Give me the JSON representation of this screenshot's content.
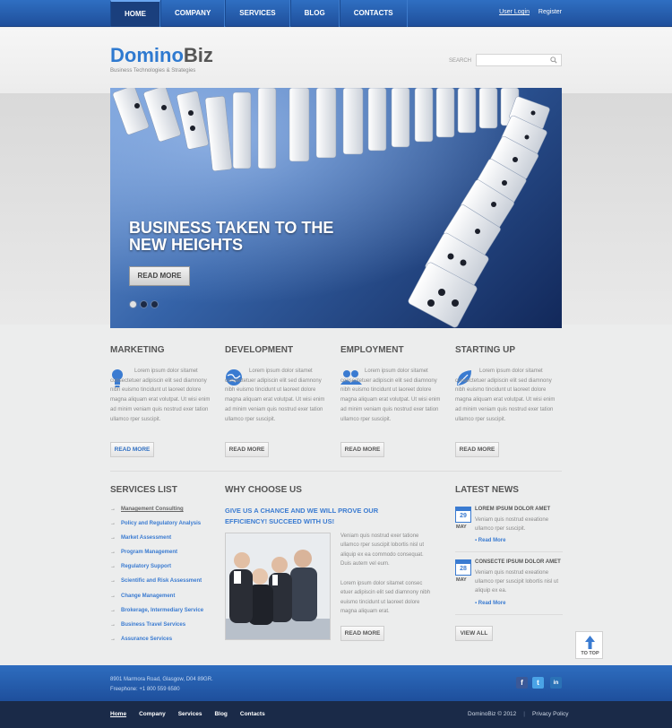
{
  "nav": {
    "items": [
      "HOME",
      "COMPANY",
      "SERVICES",
      "BLOG",
      "CONTACTS"
    ],
    "active": "HOME",
    "user_login": "User Login",
    "register": "Register"
  },
  "header": {
    "logo_part1": "Domino",
    "logo_part2": "Biz",
    "tagline": "Business Technologies & Strategies",
    "search_label": "SEARCH",
    "search_value": ""
  },
  "slider": {
    "title": "BUSINESS TAKEN TO THE NEW HEIGHTS",
    "button": "READ MORE",
    "slides": 3,
    "active_slide": 1
  },
  "features": [
    {
      "title": "MARKETING",
      "icon": "lightbulb-icon",
      "text": "Lorem ipsum dolor sitamet consectetuer adipiscin elit sed diamnony nibh euismo tincidunt ut laoreet dolore magna aliquam erat volutpat. Ut wisi enim ad minim veniam quis nostrud exer tation ullamco rper suscipit.",
      "button": "READ MORE"
    },
    {
      "title": "DEVELOPMENT",
      "icon": "globe-icon",
      "text": "Lorem ipsum dolor sitamet consectetuer adipiscin elit sed diamnony nibh euismo tincidunt ut laoreet dolore magna aliquam erat volutpat. Ut wisi enim ad minim veniam quis nostrud exer tation ullamco rper suscipit.",
      "button": "READ MORE"
    },
    {
      "title": "EMPLOYMENT",
      "icon": "users-icon",
      "text": "Lorem ipsum dolor sitamet consectetuer adipiscin elit sed diamnony nibh euismo tincidunt ut laoreet dolore magna aliquam erat volutpat. Ut wisi enim ad minim veniam quis nostrud exer tation ullamco rper suscipit.",
      "button": "READ MORE"
    },
    {
      "title": "STARTING UP",
      "icon": "leaf-icon",
      "text": "Lorem ipsum dolor sitamet consectetuer adipiscin elit sed diamnony nibh euismo tincidunt ut laoreet dolore magna aliquam erat volutpat. Ut wisi enim ad minim veniam quis nostrud exer tation ullamco rper suscipit.",
      "button": "READ MORE"
    }
  ],
  "services": {
    "title": "SERVICES LIST",
    "items": [
      "Management Consulting",
      "Policy and Regulatory Analysis",
      "Market Assessment",
      "Program Management",
      "Regulatory Support",
      "Scientific and Risk Assessment",
      "Change Management",
      "Brokerage, Intermediary Service",
      "Business Travel Services",
      "Assurance Services"
    ]
  },
  "why": {
    "title": "WHY CHOOSE US",
    "headline": "GIVE US A CHANCE AND WE WILL PROVE OUR EFFICIENCY! SUCCEED WITH US!",
    "para1": "Veniam quis nostrud exer tatione ullamco rper suscipit lobortis nisl ut aliquip ex ea commodo consequat. Duis autem vel eum.",
    "para2": "Lorem ipsum dolor sitamet consec etuer adipiscin elit sed diamnony nibh euismo tincidunt ut laoreet dolore magna aliquam erat.",
    "button": "READ MORE"
  },
  "news": {
    "title": "LATEST NEWS",
    "items": [
      {
        "day": "29",
        "month": "MAY",
        "title": "LOREM IPSUM DOLOR AMET",
        "text": "Veniam quis nostrud exeatione ullamco rper suscipit.",
        "more": "Read More"
      },
      {
        "day": "28",
        "month": "MAY",
        "title": "CONSECTE IPSUM DOLOR AMET",
        "text": "Veniam quis nostrud exeatione ullamco rper suscipit lobortis nisl ut aliquip ex ea.",
        "more": "Read More"
      }
    ],
    "view_all": "VIEW ALL"
  },
  "to_top": "TO TOP",
  "footer": {
    "address": "8901 Marmora Road, Glasgow, D04 89GR.",
    "phone": "Freephone: +1 800 559 6580",
    "social": [
      "facebook-icon",
      "twitter-icon",
      "linkedin-icon"
    ],
    "links": [
      "Home",
      "Company",
      "Services",
      "Blog",
      "Contacts"
    ],
    "copyright": "DominoBiz © 2012",
    "privacy": "Privacy Policy"
  },
  "colors": {
    "accent": "#3a7bd1",
    "nav_blue": "#2a63b5",
    "footer_dark": "#1a2a48"
  }
}
